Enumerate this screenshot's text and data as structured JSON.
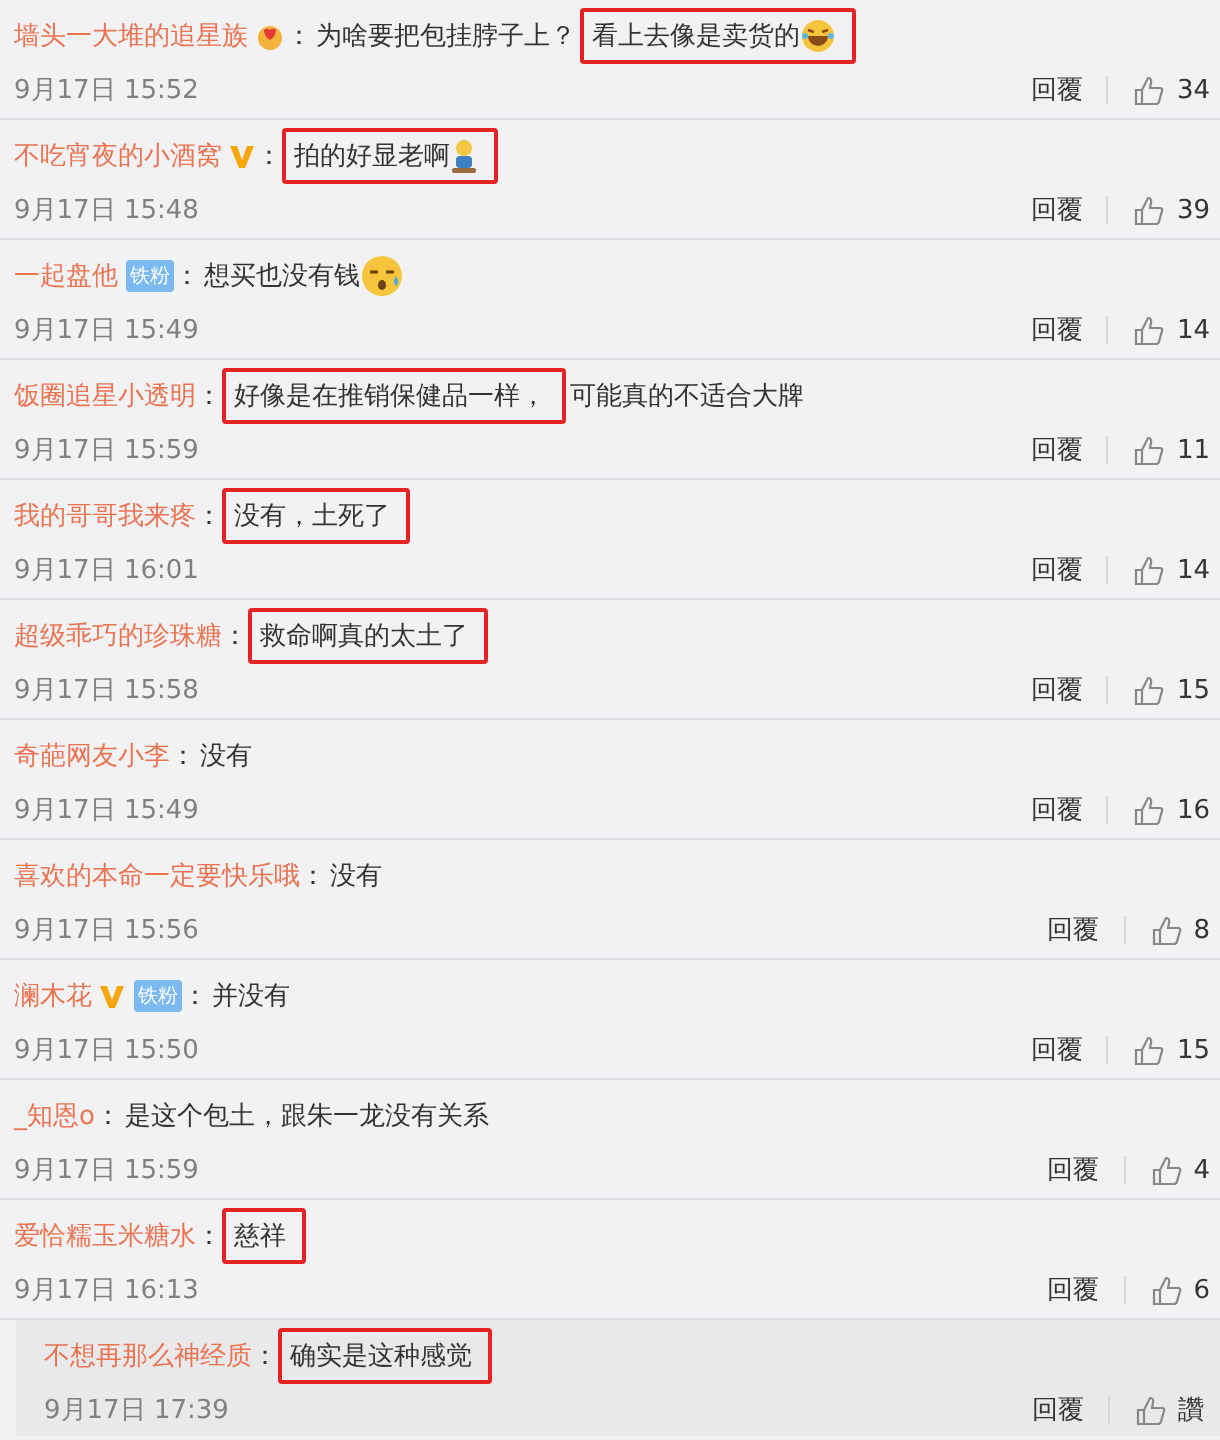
{
  "comments": [
    {
      "user": "墙头一大堆的追星族",
      "vip": false,
      "heart_badge": true,
      "colon": "：",
      "segments": [
        {
          "highlighted": false,
          "parts": [
            {
              "kind": "text",
              "text": "为啥要把包挂脖子上？"
            }
          ]
        },
        {
          "highlighted": true,
          "parts": [
            {
              "kind": "text",
              "text": "看上去像是卖货的"
            },
            {
              "kind": "laugh"
            }
          ]
        }
      ],
      "time": "9月17日 15:52",
      "reply": "回覆",
      "likes": "34",
      "nested": false
    },
    {
      "user": "不吃宵夜的小酒窝",
      "vip": true,
      "heart_badge": false,
      "colon": "：",
      "segments": [
        {
          "highlighted": true,
          "parts": [
            {
              "kind": "text",
              "text": "拍的好显老啊"
            },
            {
              "kind": "figure"
            }
          ]
        }
      ],
      "time": "9月17日 15:48",
      "reply": "回覆",
      "likes": "39",
      "nested": false
    },
    {
      "user": "一起盘他",
      "vip": false,
      "fan_badge": "铁粉",
      "heart_badge": false,
      "colon": "：",
      "segments": [
        {
          "highlighted": false,
          "parts": [
            {
              "kind": "text",
              "text": "想买也没有钱"
            },
            {
              "kind": "sweat"
            }
          ]
        }
      ],
      "time": "9月17日 15:49",
      "reply": "回覆",
      "likes": "14",
      "nested": false
    },
    {
      "user": "饭圈追星小透明",
      "vip": false,
      "heart_badge": false,
      "colon": "：",
      "segments": [
        {
          "highlighted": true,
          "parts": [
            {
              "kind": "text",
              "text": "好像是在推销保健品一样，"
            }
          ]
        },
        {
          "highlighted": false,
          "parts": [
            {
              "kind": "text",
              "text": "可能真的不适合大牌"
            }
          ]
        }
      ],
      "time": "9月17日 15:59",
      "reply": "回覆",
      "likes": "11",
      "nested": false
    },
    {
      "user": "我的哥哥我来疼",
      "vip": false,
      "heart_badge": false,
      "colon": "：",
      "segments": [
        {
          "highlighted": true,
          "parts": [
            {
              "kind": "text",
              "text": "没有，土死了"
            }
          ]
        }
      ],
      "time": "9月17日 16:01",
      "reply": "回覆",
      "likes": "14",
      "nested": false
    },
    {
      "user": "超级乖巧的珍珠糖",
      "vip": false,
      "heart_badge": false,
      "colon": "：",
      "segments": [
        {
          "highlighted": true,
          "parts": [
            {
              "kind": "text",
              "text": "救命啊真的太土了"
            }
          ]
        }
      ],
      "time": "9月17日 15:58",
      "reply": "回覆",
      "likes": "15",
      "nested": false
    },
    {
      "user": "奇葩网友小李",
      "vip": false,
      "heart_badge": false,
      "colon": "：",
      "segments": [
        {
          "highlighted": false,
          "parts": [
            {
              "kind": "text",
              "text": "没有"
            }
          ]
        }
      ],
      "time": "9月17日 15:49",
      "reply": "回覆",
      "likes": "16",
      "nested": false
    },
    {
      "user": "喜欢的本命一定要快乐哦",
      "vip": false,
      "heart_badge": false,
      "colon": "：",
      "segments": [
        {
          "highlighted": false,
          "parts": [
            {
              "kind": "text",
              "text": "没有"
            }
          ]
        }
      ],
      "time": "9月17日 15:56",
      "reply": "回覆",
      "likes": "8",
      "nested": false
    },
    {
      "user": "澜木花",
      "vip": true,
      "fan_badge": "铁粉",
      "heart_badge": false,
      "colon": "：",
      "segments": [
        {
          "highlighted": false,
          "parts": [
            {
              "kind": "text",
              "text": "并没有"
            }
          ]
        }
      ],
      "time": "9月17日 15:50",
      "reply": "回覆",
      "likes": "15",
      "nested": false
    },
    {
      "user": "_知恩o",
      "vip": false,
      "heart_badge": false,
      "colon": "：",
      "segments": [
        {
          "highlighted": false,
          "parts": [
            {
              "kind": "text",
              "text": "是这个包土，跟朱一龙没有关系"
            }
          ]
        }
      ],
      "time": "9月17日 15:59",
      "reply": "回覆",
      "likes": "4",
      "nested": false
    },
    {
      "user": "爱恰糯玉米糖水",
      "vip": false,
      "heart_badge": false,
      "colon": "：",
      "segments": [
        {
          "highlighted": true,
          "parts": [
            {
              "kind": "text",
              "text": "慈祥"
            }
          ]
        }
      ],
      "time": "9月17日 16:13",
      "reply": "回覆",
      "likes": "6",
      "nested": false
    },
    {
      "user": "不想再那么神经质",
      "vip": false,
      "heart_badge": false,
      "colon": "：",
      "segments": [
        {
          "highlighted": true,
          "parts": [
            {
              "kind": "text",
              "text": "确实是这种感觉"
            }
          ]
        }
      ],
      "time": "9月17日 17:39",
      "reply": "回覆",
      "likes": "讚",
      "nested": true
    }
  ]
}
